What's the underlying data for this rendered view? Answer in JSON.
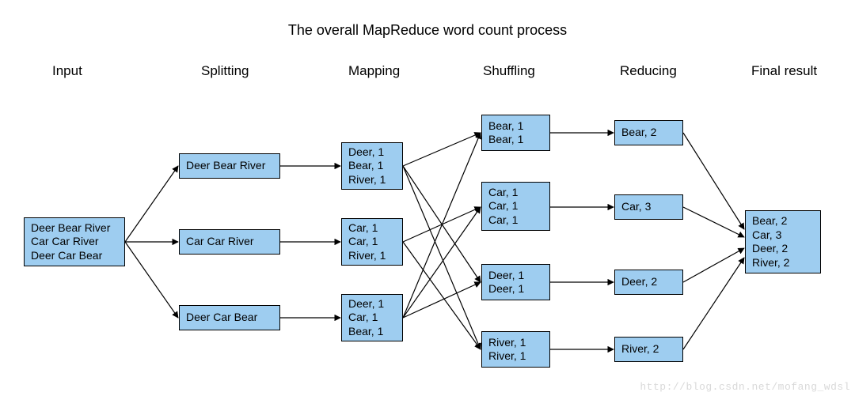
{
  "title": "The overall MapReduce word count process",
  "headers": {
    "input": "Input",
    "splitting": "Splitting",
    "mapping": "Mapping",
    "shuffling": "Shuffling",
    "reducing": "Reducing",
    "final": "Final result"
  },
  "input_box": "Deer Bear River\nCar Car River\nDeer Car Bear",
  "splitting": [
    "Deer Bear River",
    "Car Car River",
    "Deer Car Bear"
  ],
  "mapping": [
    "Deer, 1\nBear, 1\nRiver, 1",
    "Car, 1\nCar, 1\nRiver, 1",
    "Deer, 1\nCar, 1\nBear, 1"
  ],
  "shuffling": [
    "Bear, 1\nBear, 1",
    "Car, 1\nCar, 1\nCar, 1",
    "Deer, 1\nDeer, 1",
    "River, 1\nRiver, 1"
  ],
  "reducing": [
    "Bear, 2",
    "Car, 3",
    "Deer, 2",
    "River, 2"
  ],
  "final_box": "Bear, 2\nCar, 3\nDeer, 2\nRiver, 2",
  "watermark": "http://blog.csdn.net/mofang_wdsl",
  "chart_data": {
    "type": "table",
    "title": "The overall MapReduce word count process",
    "stages": [
      "Input",
      "Splitting",
      "Mapping",
      "Shuffling",
      "Reducing",
      "Final result"
    ],
    "input_lines": [
      "Deer Bear River",
      "Car Car River",
      "Deer Car Bear"
    ],
    "splits": [
      [
        "Deer",
        "Bear",
        "River"
      ],
      [
        "Car",
        "Car",
        "River"
      ],
      [
        "Deer",
        "Car",
        "Bear"
      ]
    ],
    "mapped_pairs": [
      [
        [
          "Deer",
          1
        ],
        [
          "Bear",
          1
        ],
        [
          "River",
          1
        ]
      ],
      [
        [
          "Car",
          1
        ],
        [
          "Car",
          1
        ],
        [
          "River",
          1
        ]
      ],
      [
        [
          "Deer",
          1
        ],
        [
          "Car",
          1
        ],
        [
          "Bear",
          1
        ]
      ]
    ],
    "shuffled": {
      "Bear": [
        1,
        1
      ],
      "Car": [
        1,
        1,
        1
      ],
      "Deer": [
        1,
        1
      ],
      "River": [
        1,
        1
      ]
    },
    "reduced": {
      "Bear": 2,
      "Car": 3,
      "Deer": 2,
      "River": 2
    },
    "final": {
      "Bear": 2,
      "Car": 3,
      "Deer": 2,
      "River": 2
    },
    "edges": [
      [
        "input",
        "split0"
      ],
      [
        "input",
        "split1"
      ],
      [
        "input",
        "split2"
      ],
      [
        "split0",
        "map0"
      ],
      [
        "split1",
        "map1"
      ],
      [
        "split2",
        "map2"
      ],
      [
        "map0",
        "shufBear"
      ],
      [
        "map0",
        "shufDeer"
      ],
      [
        "map0",
        "shufRiver"
      ],
      [
        "map1",
        "shufCar"
      ],
      [
        "map1",
        "shufRiver"
      ],
      [
        "map2",
        "shufBear"
      ],
      [
        "map2",
        "shufCar"
      ],
      [
        "map2",
        "shufDeer"
      ],
      [
        "shufBear",
        "redBear"
      ],
      [
        "shufCar",
        "redCar"
      ],
      [
        "shufDeer",
        "redDeer"
      ],
      [
        "shufRiver",
        "redRiver"
      ],
      [
        "redBear",
        "final"
      ],
      [
        "redCar",
        "final"
      ],
      [
        "redDeer",
        "final"
      ],
      [
        "redRiver",
        "final"
      ]
    ]
  }
}
